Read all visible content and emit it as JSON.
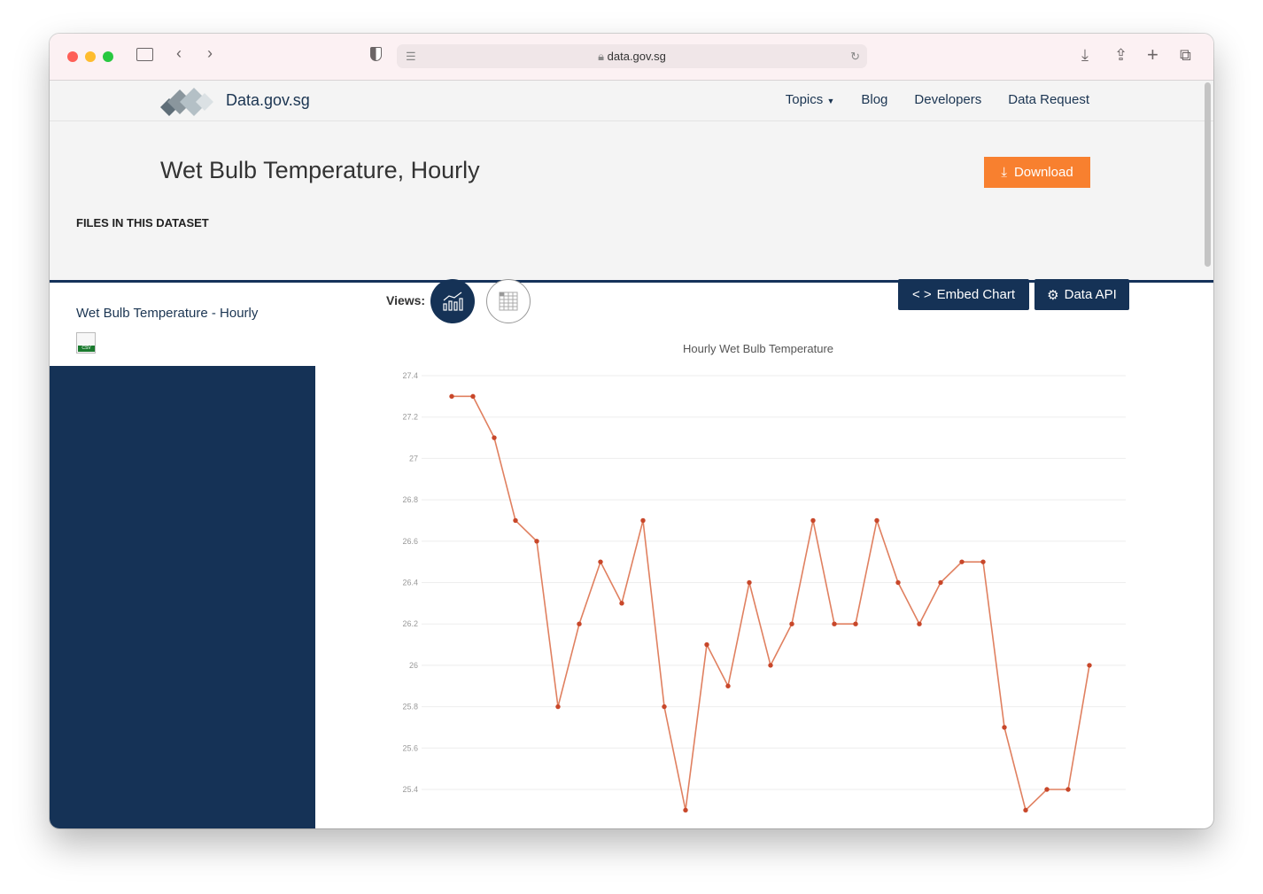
{
  "browser": {
    "url": "data.gov.sg"
  },
  "nav": {
    "brand": "Data.gov.sg",
    "links": [
      "Topics",
      "Blog",
      "Developers",
      "Data Request"
    ]
  },
  "header": {
    "title": "Wet Bulb Temperature, Hourly",
    "download": "Download",
    "files_heading": "FILES IN THIS DATASET"
  },
  "sidebar": {
    "file_name": "Wet Bulb Temperature - Hourly",
    "file_type": "CSV"
  },
  "views": {
    "label": "Views:",
    "embed": "Embed Chart",
    "api": "Data API"
  },
  "colors": {
    "accent": "#f8802f",
    "navy": "#153256",
    "line": "#e08060",
    "point": "#c8472a"
  },
  "chart_data": {
    "type": "line",
    "title": "Hourly Wet Bulb Temperature",
    "xlabel": "",
    "ylabel": "",
    "ylim": [
      25.3,
      27.4
    ],
    "yticks": [
      27.4,
      27.2,
      27,
      26.8,
      26.6,
      26.4,
      26.2,
      26,
      25.8,
      25.6,
      25.4
    ],
    "grid": true,
    "values": [
      27.3,
      27.3,
      27.1,
      26.7,
      26.6,
      25.8,
      26.2,
      26.5,
      26.3,
      26.7,
      25.8,
      25.3,
      26.1,
      25.9,
      26.4,
      26.0,
      26.2,
      26.7,
      26.2,
      26.2,
      26.7,
      26.4,
      26.2,
      26.4,
      26.5,
      26.5,
      25.7,
      25.3,
      25.4,
      25.4,
      26.0
    ]
  }
}
